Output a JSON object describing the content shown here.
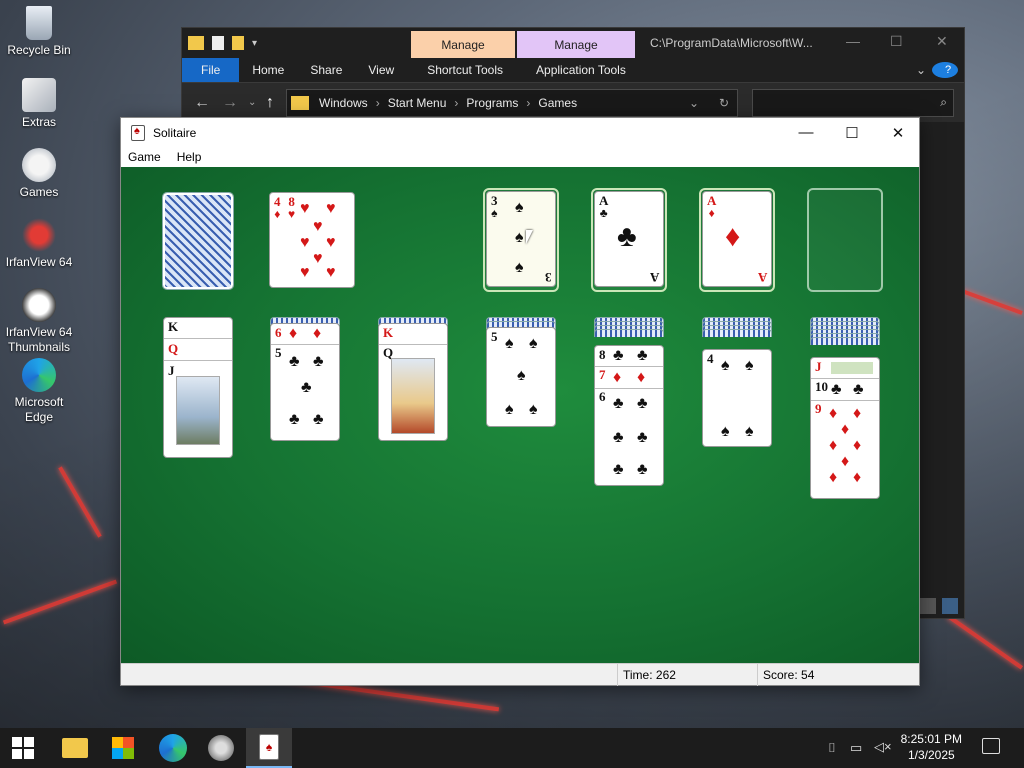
{
  "desktop": {
    "icons": [
      {
        "label": "Recycle Bin"
      },
      {
        "label": "Extras"
      },
      {
        "label": "Games"
      },
      {
        "label": "IrfanView 64"
      },
      {
        "label": "IrfanView 64 Thumbnails"
      },
      {
        "label": "Microsoft Edge"
      }
    ]
  },
  "explorer": {
    "manage_tabs": [
      "Manage",
      "Manage"
    ],
    "title_path": "C:\\ProgramData\\Microsoft\\W...",
    "ribbon": [
      "File",
      "Home",
      "Share",
      "View",
      "Shortcut Tools",
      "Application Tools"
    ],
    "breadcrumb": [
      "Windows",
      "Start Menu",
      "Programs",
      "Games"
    ]
  },
  "solitaire": {
    "title": "Solitaire",
    "menu": [
      "Game",
      "Help"
    ],
    "status": {
      "time_label": "Time:",
      "time_value": "262",
      "score_label": "Score:",
      "score_value": "54"
    },
    "waste": [
      "4",
      "8"
    ],
    "foundations": [
      {
        "rank": "3",
        "suit": "♠",
        "color": "black"
      },
      {
        "rank": "A",
        "suit": "♣",
        "color": "black"
      },
      {
        "rank": "A",
        "suit": "♦",
        "color": "red"
      }
    ],
    "tableau": [
      {
        "cards": [
          "K",
          "Q",
          "J"
        ]
      },
      {
        "cards": [
          "6",
          "5"
        ]
      },
      {
        "cards": [
          "K",
          "Q"
        ]
      },
      {
        "cards": [
          "5"
        ]
      },
      {
        "cards": [
          "8",
          "7",
          "6"
        ]
      },
      {
        "cards": [
          "4"
        ]
      },
      {
        "cards": [
          "J",
          "10",
          "9"
        ]
      }
    ]
  },
  "taskbar": {
    "clock_time": "8:25:01 PM",
    "clock_date": "1/3/2025"
  }
}
